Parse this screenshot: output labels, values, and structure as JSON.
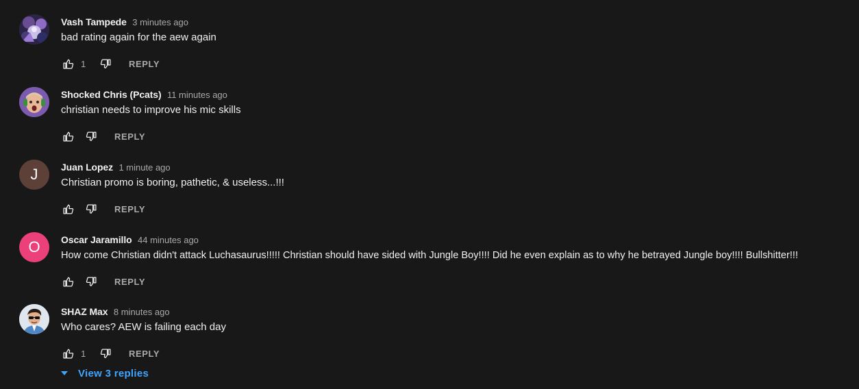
{
  "comments": [
    {
      "author": "Vash Tampede",
      "time": "3 minutes ago",
      "text": "bad rating again for the aew again",
      "likes": "1",
      "reply_label": "REPLY",
      "avatar": {
        "type": "image",
        "icon": "anime-art-avatar",
        "bg": "#3b2d55"
      }
    },
    {
      "author": "Shocked Chris (Pcats)",
      "time": "11 minutes ago",
      "text": "christian needs to improve his mic skills",
      "likes": "",
      "reply_label": "REPLY",
      "avatar": {
        "type": "image",
        "icon": "shocked-face-avatar",
        "bg": "#7b5bb0"
      }
    },
    {
      "author": "Juan Lopez",
      "time": "1 minute ago",
      "text": "Christian promo is boring, pathetic, & useless...!!!",
      "likes": "",
      "reply_label": "REPLY",
      "avatar": {
        "type": "letter",
        "letter": "J",
        "bg": "#5d4037"
      }
    },
    {
      "author": "Oscar Jaramillo",
      "time": "44 minutes ago",
      "text": "How come Christian didn't attack Luchasaurus!!!!! Christian should have sided with Jungle Boy!!!! Did he even explain as to why he betrayed Jungle boy!!!! Bullshitter!!!",
      "likes": "",
      "reply_label": "REPLY",
      "avatar": {
        "type": "letter",
        "letter": "O",
        "bg": "#ec407a"
      }
    },
    {
      "author": "SHAZ Max",
      "time": "8 minutes ago",
      "text": "Who cares? AEW is failing each day",
      "likes": "1",
      "reply_label": "REPLY",
      "avatar": {
        "type": "image",
        "icon": "person-with-sunglasses-avatar",
        "bg": "#dfe6ee"
      }
    }
  ],
  "view_replies_label": "View 3 replies",
  "colors": {
    "background": "#181818",
    "text": "#f1f1f1",
    "secondary": "#aaaaaa",
    "link": "#3ea6ff"
  }
}
